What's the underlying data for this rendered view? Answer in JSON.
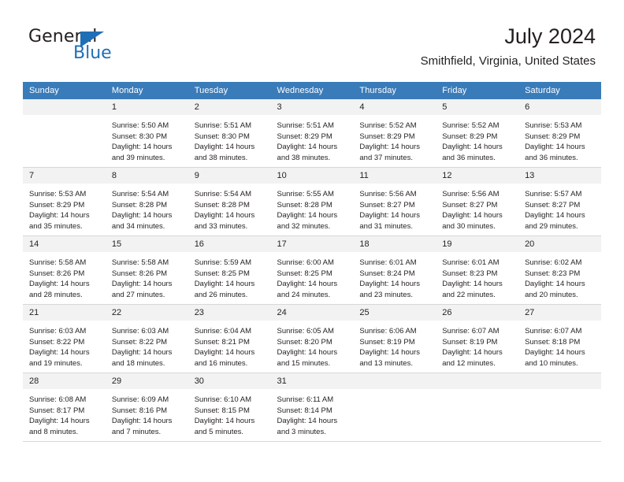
{
  "logo": {
    "primary_text": "General",
    "secondary_text": "Blue",
    "accent_color": "#1f6fb7"
  },
  "header": {
    "title": "July 2024",
    "subtitle": "Smithfield, Virginia, United States"
  },
  "theme": {
    "header_row_bg": "#3a7cba",
    "daynum_bg": "#f2f2f2",
    "grid_line": "#d8d8d8",
    "text": "#231f20"
  },
  "calendar": {
    "weekday_headers": [
      "Sunday",
      "Monday",
      "Tuesday",
      "Wednesday",
      "Thursday",
      "Friday",
      "Saturday"
    ],
    "weeks": [
      [
        {
          "day": "",
          "empty": true,
          "sunrise": "",
          "sunset": "",
          "daylight_line1": "",
          "daylight_line2": ""
        },
        {
          "day": "1",
          "empty": false,
          "sunrise": "Sunrise: 5:50 AM",
          "sunset": "Sunset: 8:30 PM",
          "daylight_line1": "Daylight: 14 hours",
          "daylight_line2": "and 39 minutes."
        },
        {
          "day": "2",
          "empty": false,
          "sunrise": "Sunrise: 5:51 AM",
          "sunset": "Sunset: 8:30 PM",
          "daylight_line1": "Daylight: 14 hours",
          "daylight_line2": "and 38 minutes."
        },
        {
          "day": "3",
          "empty": false,
          "sunrise": "Sunrise: 5:51 AM",
          "sunset": "Sunset: 8:29 PM",
          "daylight_line1": "Daylight: 14 hours",
          "daylight_line2": "and 38 minutes."
        },
        {
          "day": "4",
          "empty": false,
          "sunrise": "Sunrise: 5:52 AM",
          "sunset": "Sunset: 8:29 PM",
          "daylight_line1": "Daylight: 14 hours",
          "daylight_line2": "and 37 minutes."
        },
        {
          "day": "5",
          "empty": false,
          "sunrise": "Sunrise: 5:52 AM",
          "sunset": "Sunset: 8:29 PM",
          "daylight_line1": "Daylight: 14 hours",
          "daylight_line2": "and 36 minutes."
        },
        {
          "day": "6",
          "empty": false,
          "sunrise": "Sunrise: 5:53 AM",
          "sunset": "Sunset: 8:29 PM",
          "daylight_line1": "Daylight: 14 hours",
          "daylight_line2": "and 36 minutes."
        }
      ],
      [
        {
          "day": "7",
          "empty": false,
          "sunrise": "Sunrise: 5:53 AM",
          "sunset": "Sunset: 8:29 PM",
          "daylight_line1": "Daylight: 14 hours",
          "daylight_line2": "and 35 minutes."
        },
        {
          "day": "8",
          "empty": false,
          "sunrise": "Sunrise: 5:54 AM",
          "sunset": "Sunset: 8:28 PM",
          "daylight_line1": "Daylight: 14 hours",
          "daylight_line2": "and 34 minutes."
        },
        {
          "day": "9",
          "empty": false,
          "sunrise": "Sunrise: 5:54 AM",
          "sunset": "Sunset: 8:28 PM",
          "daylight_line1": "Daylight: 14 hours",
          "daylight_line2": "and 33 minutes."
        },
        {
          "day": "10",
          "empty": false,
          "sunrise": "Sunrise: 5:55 AM",
          "sunset": "Sunset: 8:28 PM",
          "daylight_line1": "Daylight: 14 hours",
          "daylight_line2": "and 32 minutes."
        },
        {
          "day": "11",
          "empty": false,
          "sunrise": "Sunrise: 5:56 AM",
          "sunset": "Sunset: 8:27 PM",
          "daylight_line1": "Daylight: 14 hours",
          "daylight_line2": "and 31 minutes."
        },
        {
          "day": "12",
          "empty": false,
          "sunrise": "Sunrise: 5:56 AM",
          "sunset": "Sunset: 8:27 PM",
          "daylight_line1": "Daylight: 14 hours",
          "daylight_line2": "and 30 minutes."
        },
        {
          "day": "13",
          "empty": false,
          "sunrise": "Sunrise: 5:57 AM",
          "sunset": "Sunset: 8:27 PM",
          "daylight_line1": "Daylight: 14 hours",
          "daylight_line2": "and 29 minutes."
        }
      ],
      [
        {
          "day": "14",
          "empty": false,
          "sunrise": "Sunrise: 5:58 AM",
          "sunset": "Sunset: 8:26 PM",
          "daylight_line1": "Daylight: 14 hours",
          "daylight_line2": "and 28 minutes."
        },
        {
          "day": "15",
          "empty": false,
          "sunrise": "Sunrise: 5:58 AM",
          "sunset": "Sunset: 8:26 PM",
          "daylight_line1": "Daylight: 14 hours",
          "daylight_line2": "and 27 minutes."
        },
        {
          "day": "16",
          "empty": false,
          "sunrise": "Sunrise: 5:59 AM",
          "sunset": "Sunset: 8:25 PM",
          "daylight_line1": "Daylight: 14 hours",
          "daylight_line2": "and 26 minutes."
        },
        {
          "day": "17",
          "empty": false,
          "sunrise": "Sunrise: 6:00 AM",
          "sunset": "Sunset: 8:25 PM",
          "daylight_line1": "Daylight: 14 hours",
          "daylight_line2": "and 24 minutes."
        },
        {
          "day": "18",
          "empty": false,
          "sunrise": "Sunrise: 6:01 AM",
          "sunset": "Sunset: 8:24 PM",
          "daylight_line1": "Daylight: 14 hours",
          "daylight_line2": "and 23 minutes."
        },
        {
          "day": "19",
          "empty": false,
          "sunrise": "Sunrise: 6:01 AM",
          "sunset": "Sunset: 8:23 PM",
          "daylight_line1": "Daylight: 14 hours",
          "daylight_line2": "and 22 minutes."
        },
        {
          "day": "20",
          "empty": false,
          "sunrise": "Sunrise: 6:02 AM",
          "sunset": "Sunset: 8:23 PM",
          "daylight_line1": "Daylight: 14 hours",
          "daylight_line2": "and 20 minutes."
        }
      ],
      [
        {
          "day": "21",
          "empty": false,
          "sunrise": "Sunrise: 6:03 AM",
          "sunset": "Sunset: 8:22 PM",
          "daylight_line1": "Daylight: 14 hours",
          "daylight_line2": "and 19 minutes."
        },
        {
          "day": "22",
          "empty": false,
          "sunrise": "Sunrise: 6:03 AM",
          "sunset": "Sunset: 8:22 PM",
          "daylight_line1": "Daylight: 14 hours",
          "daylight_line2": "and 18 minutes."
        },
        {
          "day": "23",
          "empty": false,
          "sunrise": "Sunrise: 6:04 AM",
          "sunset": "Sunset: 8:21 PM",
          "daylight_line1": "Daylight: 14 hours",
          "daylight_line2": "and 16 minutes."
        },
        {
          "day": "24",
          "empty": false,
          "sunrise": "Sunrise: 6:05 AM",
          "sunset": "Sunset: 8:20 PM",
          "daylight_line1": "Daylight: 14 hours",
          "daylight_line2": "and 15 minutes."
        },
        {
          "day": "25",
          "empty": false,
          "sunrise": "Sunrise: 6:06 AM",
          "sunset": "Sunset: 8:19 PM",
          "daylight_line1": "Daylight: 14 hours",
          "daylight_line2": "and 13 minutes."
        },
        {
          "day": "26",
          "empty": false,
          "sunrise": "Sunrise: 6:07 AM",
          "sunset": "Sunset: 8:19 PM",
          "daylight_line1": "Daylight: 14 hours",
          "daylight_line2": "and 12 minutes."
        },
        {
          "day": "27",
          "empty": false,
          "sunrise": "Sunrise: 6:07 AM",
          "sunset": "Sunset: 8:18 PM",
          "daylight_line1": "Daylight: 14 hours",
          "daylight_line2": "and 10 minutes."
        }
      ],
      [
        {
          "day": "28",
          "empty": false,
          "sunrise": "Sunrise: 6:08 AM",
          "sunset": "Sunset: 8:17 PM",
          "daylight_line1": "Daylight: 14 hours",
          "daylight_line2": "and 8 minutes."
        },
        {
          "day": "29",
          "empty": false,
          "sunrise": "Sunrise: 6:09 AM",
          "sunset": "Sunset: 8:16 PM",
          "daylight_line1": "Daylight: 14 hours",
          "daylight_line2": "and 7 minutes."
        },
        {
          "day": "30",
          "empty": false,
          "sunrise": "Sunrise: 6:10 AM",
          "sunset": "Sunset: 8:15 PM",
          "daylight_line1": "Daylight: 14 hours",
          "daylight_line2": "and 5 minutes."
        },
        {
          "day": "31",
          "empty": false,
          "sunrise": "Sunrise: 6:11 AM",
          "sunset": "Sunset: 8:14 PM",
          "daylight_line1": "Daylight: 14 hours",
          "daylight_line2": "and 3 minutes."
        },
        {
          "day": "",
          "empty": true,
          "sunrise": "",
          "sunset": "",
          "daylight_line1": "",
          "daylight_line2": ""
        },
        {
          "day": "",
          "empty": true,
          "sunrise": "",
          "sunset": "",
          "daylight_line1": "",
          "daylight_line2": ""
        },
        {
          "day": "",
          "empty": true,
          "sunrise": "",
          "sunset": "",
          "daylight_line1": "",
          "daylight_line2": ""
        }
      ]
    ]
  }
}
